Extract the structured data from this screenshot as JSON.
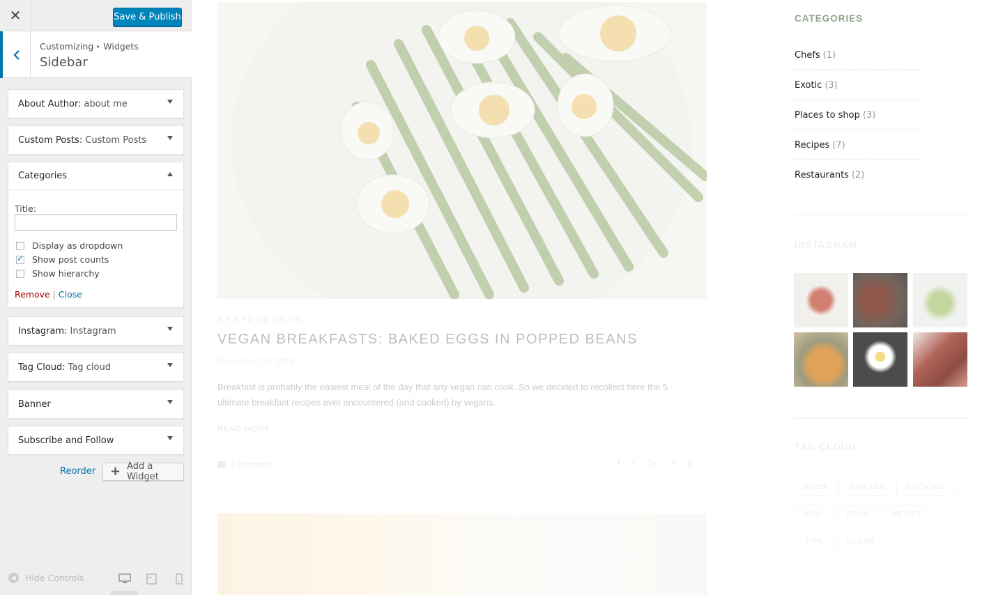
{
  "customizer": {
    "close_icon": "close-icon",
    "publish_label": "Save & Publish",
    "breadcrumb": {
      "root": "Customizing",
      "section": "Widgets"
    },
    "section_title": "Sidebar",
    "widgets": [
      {
        "name": "About Author:",
        "title": "about me"
      },
      {
        "name": "Custom Posts:",
        "title": "Custom Posts"
      },
      {
        "name": "Categories",
        "title": ""
      },
      {
        "name": "Instagram:",
        "title": "Instagram"
      },
      {
        "name": "Tag Cloud:",
        "title": "Tag cloud"
      },
      {
        "name": "Banner",
        "title": ""
      },
      {
        "name": "Subscribe and Follow",
        "title": ""
      }
    ],
    "categories_form": {
      "title_label": "Title:",
      "title_value": "",
      "options": [
        {
          "label": "Display as dropdown",
          "checked": false
        },
        {
          "label": "Show post counts",
          "checked": true
        },
        {
          "label": "Show hierarchy",
          "checked": false
        }
      ],
      "remove_label": "Remove",
      "separator": "|",
      "close_label": "Close"
    },
    "reorder_label": "Reorder",
    "add_widget_label": "Add a Widget",
    "hide_controls_label": "Hide Controls",
    "devices": [
      "desktop",
      "tablet",
      "mobile"
    ],
    "accent": "#0073aa",
    "publish_color": "#0085ba"
  },
  "preview": {
    "post": {
      "category": "RESTAURANTS",
      "title": "VEGAN BREAKFASTS: BAKED EGGS IN POPPED BEANS",
      "date": "December 20, 2018",
      "excerpt": "Breakfast is probably the easiest meal of the day that any vegan can cook. So we decided to recollect here the 5 ultimate breakfast recipes ever encountered (and cooked) by vegans.",
      "read_more": "READ MORE",
      "comments": "1 comment",
      "share": [
        "f",
        "t",
        "G+",
        "in",
        "p"
      ]
    },
    "sidebar": {
      "categories_heading": "CATEGORIES",
      "categories": [
        {
          "name": "Chefs",
          "count": "(1)"
        },
        {
          "name": "Exotic",
          "count": "(3)"
        },
        {
          "name": "Places to shop",
          "count": "(3)"
        },
        {
          "name": "Recipes",
          "count": "(7)"
        },
        {
          "name": "Restaurants",
          "count": "(2)"
        }
      ],
      "instagram_heading": "INSTAGRAM",
      "tag_heading": "TAG CLOUD",
      "tags": [
        "BLOG",
        "CHICKEN",
        "COOKING",
        "FISH",
        "FOOD",
        "RECIPE",
        "TIPS",
        "VEGAN"
      ],
      "heading_color": "#8fa588"
    }
  }
}
